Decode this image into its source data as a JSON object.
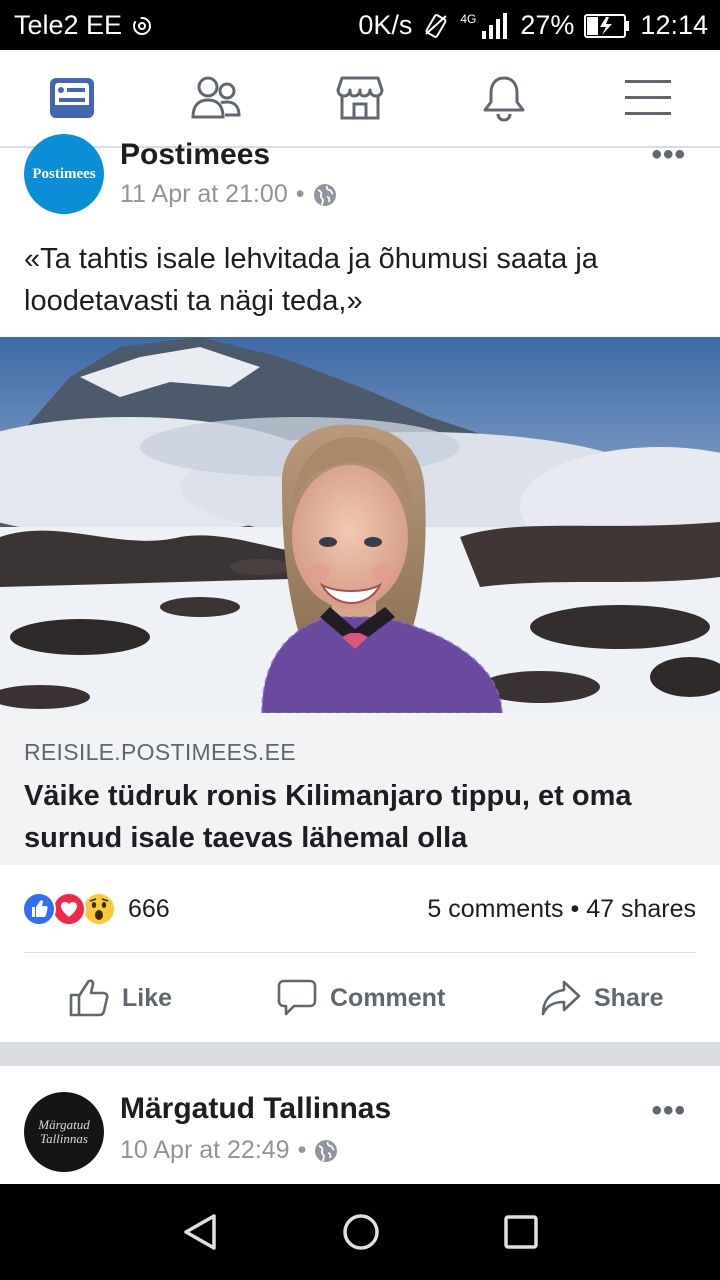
{
  "status_bar": {
    "carrier": "Tele2 EE",
    "network_speed": "0K/s",
    "network_type": "4G",
    "battery": "27%",
    "time": "12:14"
  },
  "nav": {
    "items": [
      "news-feed",
      "friends",
      "marketplace",
      "notifications",
      "menu"
    ],
    "active_color": "#4267b2"
  },
  "post1": {
    "author": "Postimees",
    "avatar_text": "Postimees",
    "avatar_color": "#0a8fd6",
    "timestamp": "11 Apr at 21:00",
    "more": "•••",
    "text": "«Ta tahtis isale lehvitada ja õhumusi saata ja loodetavasti ta nägi teda,»",
    "link": {
      "domain": "REISILE.POSTIMEES.EE",
      "title": "Väike tüdruk ronis Kilimanjaro tippu, et oma surnud isale taevas lähemal olla"
    },
    "reaction_count": "666",
    "comments": "5 comments",
    "shares": "47 shares",
    "stat_sep": "•",
    "actions": {
      "like": "Like",
      "comment": "Comment",
      "share": "Share"
    }
  },
  "post2": {
    "author": "Märgatud Tallinnas",
    "avatar_text_line1": "Märgatud",
    "avatar_text_line2": "Tallinnas",
    "timestamp": "10 Apr at 22:49",
    "more": "•••"
  }
}
